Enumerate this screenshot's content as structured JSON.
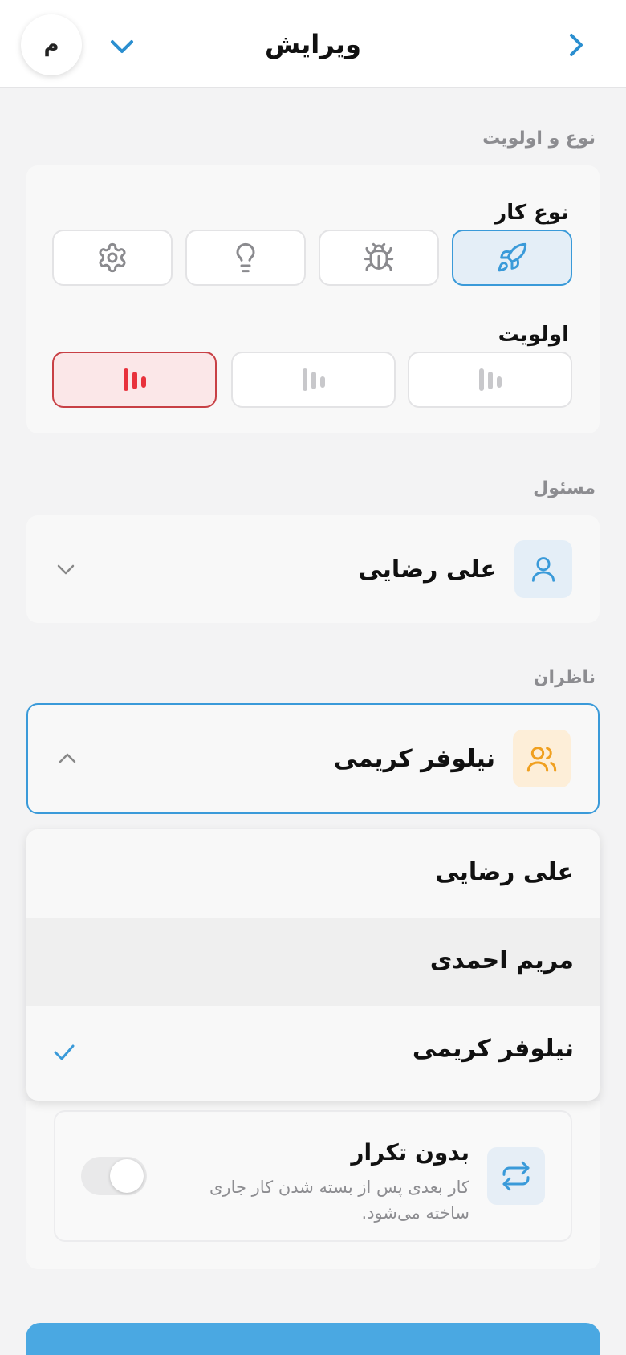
{
  "header": {
    "title": "ویرایش",
    "avatar_initial": "م"
  },
  "type_priority": {
    "section_label": "نوع و اولویت",
    "task_type_label": "نوع کار",
    "priority_label": "اولویت"
  },
  "assignee": {
    "section_label": "مسئول",
    "selected": "علی رضایی"
  },
  "watchers": {
    "section_label": "ناظران",
    "selected": "نیلوفر کریمی",
    "options": [
      {
        "label": "علی رضایی"
      },
      {
        "label": "مریم احمدی"
      },
      {
        "label": "نیلوفر کریمی"
      }
    ]
  },
  "repeat": {
    "title": "بدون تکرار",
    "description": "کار بعدی پس از بسته شدن کار جاری ساخته می‌شود."
  },
  "colors": {
    "accent": "#3a9ad9",
    "priority_high": "#e8323c",
    "watchers_icon": "#f0a020"
  }
}
